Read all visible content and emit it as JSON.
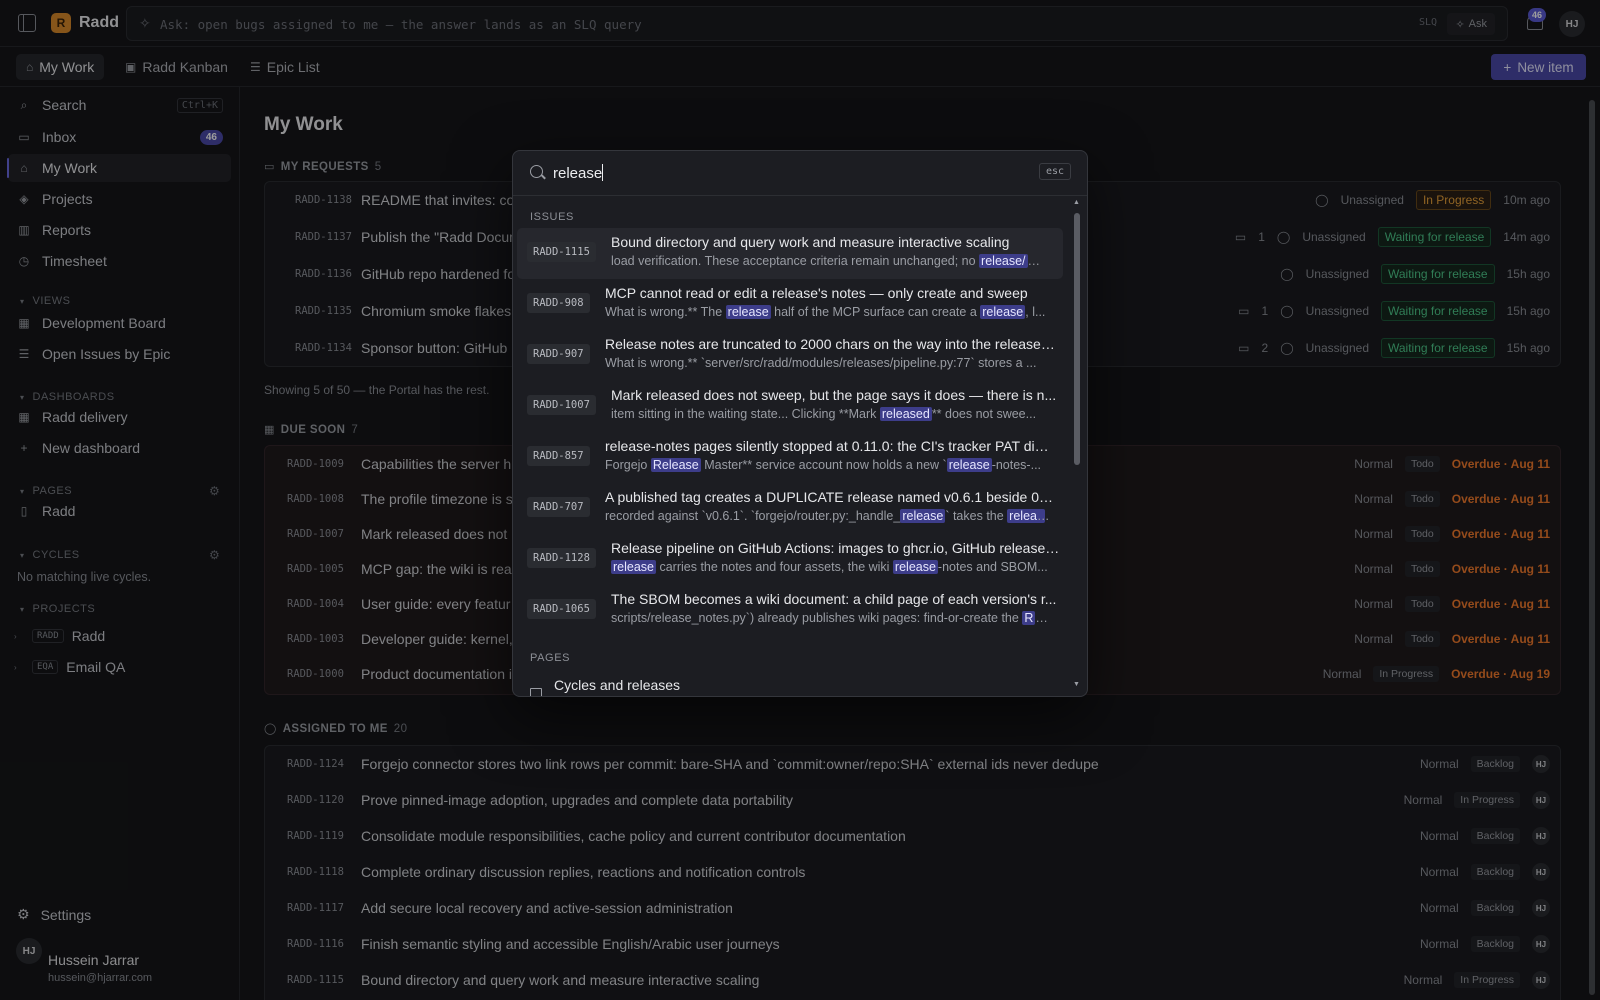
{
  "app": {
    "name": "Radd",
    "logo_glyph": "R"
  },
  "topbar": {
    "ask_placeholder": "Ask: open bugs assigned to me — the answer lands as an SLQ query",
    "slq_label": "SLQ",
    "ask_button": "Ask",
    "notification_count": "46",
    "avatar_initials": "HJ"
  },
  "tabs": [
    {
      "label": "My Work",
      "icon": "home-icon"
    },
    {
      "label": "Radd Kanban",
      "icon": "kanban-icon"
    },
    {
      "label": "Epic List",
      "icon": "list-icon"
    }
  ],
  "new_item_button": "New item",
  "sidebar": {
    "search": {
      "label": "Search",
      "shortcut": "Ctrl+K"
    },
    "inbox": {
      "label": "Inbox",
      "count": "46"
    },
    "my_work": "My Work",
    "projects": "Projects",
    "reports": "Reports",
    "timesheet": "Timesheet",
    "views_header": "VIEWS",
    "views": [
      "Development Board",
      "Open Issues by Epic"
    ],
    "dashboards_header": "DASHBOARDS",
    "dashboards": [
      "Radd delivery",
      "New dashboard"
    ],
    "pages_header": "PAGES",
    "pages": [
      "Radd"
    ],
    "cycles_header": "CYCLES",
    "cycles_empty": "No matching live cycles.",
    "projects_header": "PROJECTS",
    "project_list": [
      {
        "key": "RADD",
        "name": "Radd"
      },
      {
        "key": "EQA",
        "name": "Email QA"
      }
    ],
    "settings": "Settings",
    "user": {
      "initials": "HJ",
      "name": "Hussein Jarrar",
      "email": "hussein@hjarrar.com"
    }
  },
  "main": {
    "title": "My Work",
    "my_requests": {
      "header": "MY REQUESTS",
      "count": "5",
      "rows": [
        {
          "key": "RADD-1138",
          "title": "README that invites: co",
          "comments": "",
          "assignee": "Unassigned",
          "status": "In Progress",
          "time": "10m ago"
        },
        {
          "key": "RADD-1137",
          "title": "Publish the \"Radd Docum",
          "comments": "1",
          "assignee": "Unassigned",
          "status": "Waiting for release",
          "time": "14m ago"
        },
        {
          "key": "RADD-1136",
          "title": "GitHub repo hardened fo",
          "comments": "",
          "assignee": "Unassigned",
          "status": "Waiting for release",
          "time": "15h ago"
        },
        {
          "key": "RADD-1135",
          "title": "Chromium smoke flakes",
          "comments": "1",
          "assignee": "Unassigned",
          "status": "Waiting for release",
          "time": "15h ago"
        },
        {
          "key": "RADD-1134",
          "title": "Sponsor button: GitHub",
          "comments": "2",
          "assignee": "Unassigned",
          "status": "Waiting for release",
          "time": "15h ago"
        }
      ],
      "note": "Showing 5 of 50 — the Portal has the rest."
    },
    "due_soon": {
      "header": "DUE SOON",
      "count": "7",
      "rows": [
        {
          "key": "RADD-1009",
          "title": "Capabilities the server h",
          "priority": "Normal",
          "status": "Todo",
          "due": "Overdue · Aug 11"
        },
        {
          "key": "RADD-1008",
          "title": "The profile timezone is s",
          "priority": "Normal",
          "status": "Todo",
          "due": "Overdue · Aug 11"
        },
        {
          "key": "RADD-1007",
          "title": "Mark released does not",
          "priority": "Normal",
          "status": "Todo",
          "due": "Overdue · Aug 11"
        },
        {
          "key": "RADD-1005",
          "title": "MCP gap: the wiki is rea",
          "priority": "Normal",
          "status": "Todo",
          "due": "Overdue · Aug 11"
        },
        {
          "key": "RADD-1004",
          "title": "User guide: every featur",
          "priority": "Normal",
          "status": "Todo",
          "due": "Overdue · Aug 11"
        },
        {
          "key": "RADD-1003",
          "title": "Developer guide: kernel,",
          "priority": "Normal",
          "status": "Todo",
          "due": "Overdue · Aug 11"
        },
        {
          "key": "RADD-1000",
          "title": "Product documentation i",
          "priority": "Normal",
          "status": "In Progress",
          "due": "Overdue · Aug 19"
        }
      ]
    },
    "assigned": {
      "header": "ASSIGNED TO ME",
      "count": "20",
      "rows": [
        {
          "key": "RADD-1124",
          "title": "Forgejo connector stores two link rows per commit: bare-SHA and `commit:owner/repo:SHA` external ids never dedupe",
          "priority": "Normal",
          "status": "Backlog",
          "assignee": "HJ"
        },
        {
          "key": "RADD-1120",
          "title": "Prove pinned-image adoption, upgrades and complete data portability",
          "priority": "Normal",
          "status": "In Progress",
          "assignee": "HJ"
        },
        {
          "key": "RADD-1119",
          "title": "Consolidate module responsibilities, cache policy and current contributor documentation",
          "priority": "Normal",
          "status": "Backlog",
          "assignee": "HJ"
        },
        {
          "key": "RADD-1118",
          "title": "Complete ordinary discussion replies, reactions and notification controls",
          "priority": "Normal",
          "status": "Backlog",
          "assignee": "HJ"
        },
        {
          "key": "RADD-1117",
          "title": "Add secure local recovery and active-session administration",
          "priority": "Normal",
          "status": "Backlog",
          "assignee": "HJ"
        },
        {
          "key": "RADD-1116",
          "title": "Finish semantic styling and accessible English/Arabic user journeys",
          "priority": "Normal",
          "status": "Backlog",
          "assignee": "HJ"
        },
        {
          "key": "RADD-1115",
          "title": "Bound directory and query work and measure interactive scaling",
          "priority": "Normal",
          "status": "In Progress",
          "assignee": "HJ"
        }
      ]
    }
  },
  "palette": {
    "query": "release",
    "esc_label": "esc",
    "issues_header": "ISSUES",
    "pages_header": "PAGES",
    "results": [
      {
        "key": "RADD-1115",
        "title": "Bound directory and query work and measure interactive scaling",
        "snippet": [
          "load verification. These acceptance criteria remain unchanged; no ",
          "release/",
          ""
        ]
      },
      {
        "key": "RADD-908",
        "title": "MCP cannot read or edit a release's notes — only create and sweep",
        "snippet": [
          "What is wrong.** The ",
          "release",
          " half of the MCP surface can create a ",
          "release",
          ", l..."
        ]
      },
      {
        "key": "RADD-907",
        "title": "Release notes are truncated to 2000 chars on the way into the release r...",
        "snippet": [
          "What is wrong.** `server/src/radd/modules/releases/pipeline.py:77` stores a ..."
        ]
      },
      {
        "key": "RADD-1007",
        "title": "Mark released does not sweep, but the page says it does — there is n...",
        "snippet": [
          "item sitting in the waiting state... Clicking **Mark ",
          "released",
          "** does not swee..."
        ]
      },
      {
        "key": "RADD-857",
        "title": "release-notes pages silently stopped at 0.11.0: the CI's tracker PAT died...",
        "snippet": [
          "Forgejo ",
          "Release",
          " Master** service account now holds a new `",
          "release",
          "-notes-..."
        ]
      },
      {
        "key": "RADD-707",
        "title": "A published tag creates a DUPLICATE release named v0.6.1 beside 0.6.1",
        "snippet": [
          "recorded against `v0.6.1`. `forgejo/router.py:_handle_",
          "release",
          "` takes the ",
          "releas",
          ""
        ]
      },
      {
        "key": "RADD-1128",
        "title": "Release pipeline on GitHub Actions: images to ghcr.io, GitHub releases...",
        "snippet": [
          "",
          "release",
          " carries the notes and four assets, the wiki ",
          "release",
          "-notes and SBOM..."
        ]
      },
      {
        "key": "RADD-1065",
        "title": "The SBOM becomes a wiki document: a child page of each version's r...",
        "snippet": [
          "scripts/release_notes.py`) already publishes wiki pages: find-or-create the ",
          "R",
          ""
        ]
      }
    ],
    "page_result": "Cycles and releases"
  }
}
